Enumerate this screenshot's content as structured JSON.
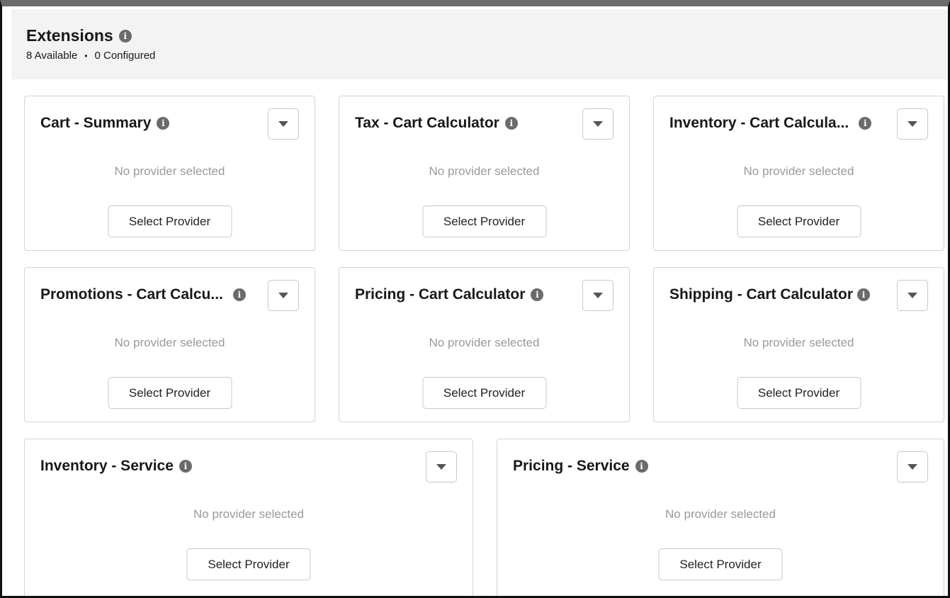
{
  "header": {
    "title": "Extensions",
    "available": "8 Available",
    "separator": "•",
    "configured": "0 Configured"
  },
  "info_glyph": "i",
  "cards": [
    {
      "title": "Cart - Summary",
      "status": "No provider selected",
      "button": "Select Provider"
    },
    {
      "title": "Tax - Cart Calculator",
      "status": "No provider selected",
      "button": "Select Provider"
    },
    {
      "title": "Inventory - Cart Calcula...",
      "status": "No provider selected",
      "button": "Select Provider"
    },
    {
      "title": "Promotions - Cart Calcu...",
      "status": "No provider selected",
      "button": "Select Provider"
    },
    {
      "title": "Pricing - Cart Calculator",
      "status": "No provider selected",
      "button": "Select Provider"
    },
    {
      "title": "Shipping - Cart Calculator",
      "status": "No provider selected",
      "button": "Select Provider"
    },
    {
      "title": "Inventory - Service",
      "status": "No provider selected",
      "button": "Select Provider"
    },
    {
      "title": "Pricing - Service",
      "status": "No provider selected",
      "button": "Select Provider"
    }
  ],
  "icons": {
    "info": "info-icon",
    "menu": "chevron-down-icon"
  }
}
